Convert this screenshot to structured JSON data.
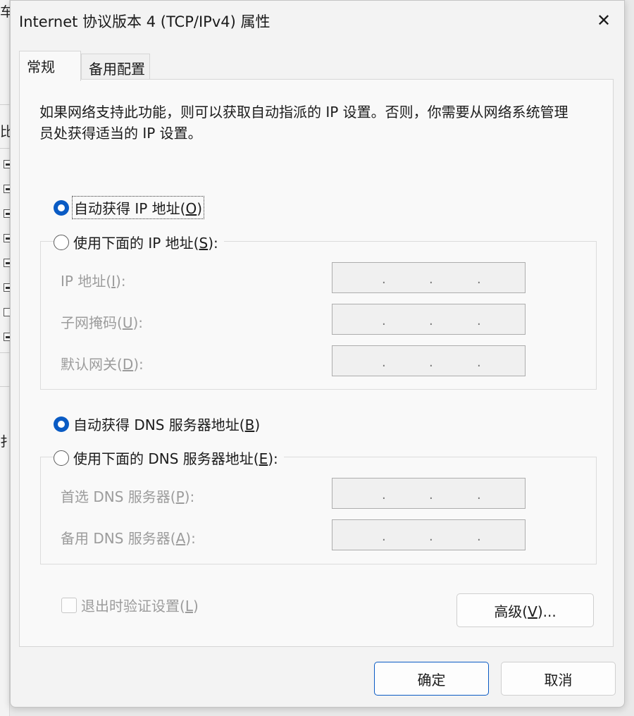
{
  "background": {
    "chars": [
      "车",
      "比",
      "扌"
    ]
  },
  "dialog": {
    "title": "Internet 协议版本 4 (TCP/IPv4) 属性",
    "close_glyph": "✕",
    "tabs": [
      {
        "label": "常规",
        "active": true
      },
      {
        "label": "备用配置",
        "active": false
      }
    ],
    "description": "如果网络支持此功能，则可以获取自动指派的 IP 设置。否则，你需要从网络系统管理员处获得适当的 IP 设置。",
    "ip_section": {
      "auto_option": {
        "text": "自动获得 IP 地址(",
        "key": "O",
        "close": ")",
        "selected": true
      },
      "manual_option": {
        "text": "使用下面的 IP 地址(",
        "key": "S",
        "close": "):",
        "selected": false
      },
      "fields": [
        {
          "text": "IP 地址(",
          "key": "I",
          "close": "):",
          "value": ""
        },
        {
          "text": "子网掩码(",
          "key": "U",
          "close": "):",
          "value": ""
        },
        {
          "text": "默认网关(",
          "key": "D",
          "close": "):",
          "value": ""
        }
      ]
    },
    "dns_section": {
      "auto_option": {
        "text": "自动获得 DNS 服务器地址(",
        "key": "B",
        "close": ")",
        "selected": true
      },
      "manual_option": {
        "text": "使用下面的 DNS 服务器地址(",
        "key": "E",
        "close": "):",
        "selected": false
      },
      "fields": [
        {
          "text": "首选 DNS 服务器(",
          "key": "P",
          "close": "):",
          "value": ""
        },
        {
          "text": "备用 DNS 服务器(",
          "key": "A",
          "close": "):",
          "value": ""
        }
      ]
    },
    "validate_checkbox": {
      "text": "退出时验证设置(",
      "key": "L",
      "close": ")",
      "checked": false
    },
    "advanced_button": {
      "text": "高级(",
      "key": "V",
      "close": ")..."
    },
    "ok_button": "确定",
    "cancel_button": "取消",
    "ip_separator": ".",
    "colors": {
      "accent": "#0a5bc4",
      "disabled_text": "#9c9c9c",
      "panel": "#f9f9f9",
      "window": "#f3f3f3"
    }
  }
}
